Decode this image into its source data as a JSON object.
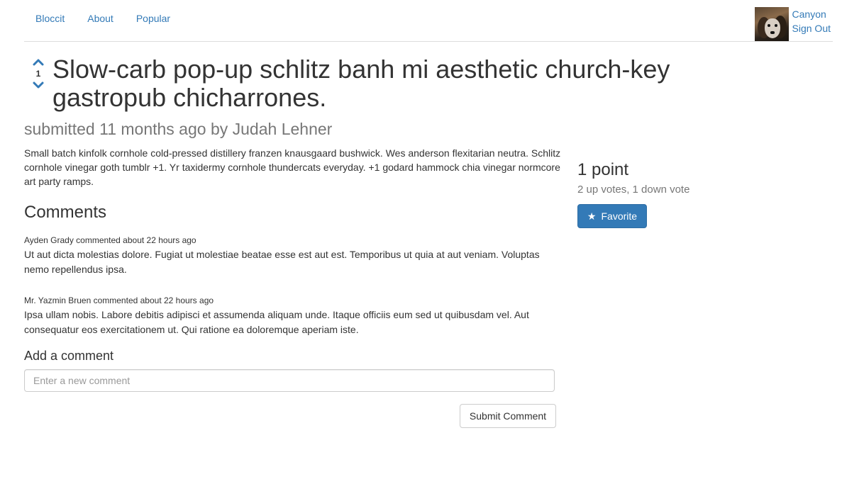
{
  "nav": {
    "links": [
      {
        "label": "Bloccit"
      },
      {
        "label": "About"
      },
      {
        "label": "Popular"
      }
    ],
    "user": {
      "name": "Canyon",
      "sign_out": "Sign Out",
      "avatar_icon": "dog-avatar"
    }
  },
  "post": {
    "vote_count": "1",
    "upvote_icon": "chevron-up-icon",
    "downvote_icon": "chevron-down-icon",
    "title": "Slow-carb pop-up schlitz banh mi aesthetic church-key gastropub chicharrones.",
    "submitted": "submitted 11 months ago by Judah Lehner",
    "body": "Small batch kinfolk cornhole cold-pressed distillery franzen knausgaard bushwick. Wes anderson flexitarian neutra. Schlitz cornhole vinegar goth tumblr +1. Yr taxidermy cornhole thundercats everyday. +1 godard hammock chia vinegar normcore art party ramps."
  },
  "sidebar": {
    "points": "1 point",
    "votes_detail": "2 up votes, 1 down vote",
    "favorite_label": "Favorite",
    "favorite_icon": "star-icon"
  },
  "comments": {
    "heading": "Comments",
    "items": [
      {
        "meta": "Ayden Grady commented about 22 hours ago",
        "text": "Ut aut dicta molestias dolore. Fugiat ut molestiae beatae esse est aut est. Temporibus ut quia at aut veniam. Voluptas nemo repellendus ipsa."
      },
      {
        "meta": "Mr. Yazmin Bruen commented about 22 hours ago",
        "text": "Ipsa ullam nobis. Labore debitis adipisci et assumenda aliquam unde. Itaque officiis eum sed ut quibusdam vel. Aut consequatur eos exercitationem ut. Qui ratione ea doloremque aperiam iste."
      }
    ],
    "add_heading": "Add a comment",
    "input_placeholder": "Enter a new comment",
    "submit_label": "Submit Comment"
  },
  "colors": {
    "link": "#337ab7",
    "primary_button": "#337ab7",
    "muted_text": "#777777"
  }
}
